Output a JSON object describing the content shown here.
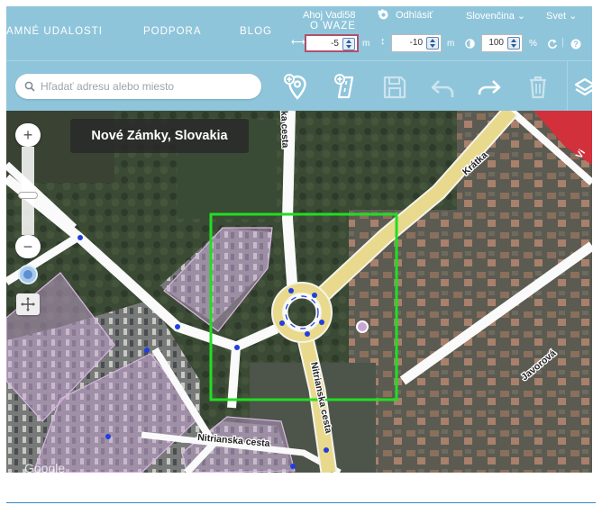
{
  "nav": {
    "items": [
      "AMNÉ UDALOSTI",
      "PODPORA",
      "BLOG",
      "O WAZE"
    ]
  },
  "user": {
    "greeting": "Ahoj Vadi58",
    "logout": "Odhlásiť",
    "language": "Slovenčina ⌄",
    "world": "Svet ⌄"
  },
  "offsets": {
    "x_value": "-5",
    "x_unit": "m",
    "y_value": "-10",
    "y_unit": "m",
    "opacity_value": "100",
    "opacity_unit": "%"
  },
  "search": {
    "placeholder": "Hľadať adresu alebo miesto"
  },
  "map": {
    "place_label": "Nové Zámky, Slovakia",
    "street_labels": [
      "Krátka",
      "Nitrianska cesta",
      "Nitrianska cesta",
      "Javorová",
      "ka cesta",
      "Vi"
    ],
    "zoom_in": "+",
    "zoom_out": "−",
    "attribution": "Google"
  },
  "colors": {
    "header": "#8fc5da",
    "selection": "#22dd22",
    "road_main": "#e8d98c",
    "road_minor": "#ffffff",
    "area": "#c9a6d6",
    "restricted": "#d2303a"
  }
}
